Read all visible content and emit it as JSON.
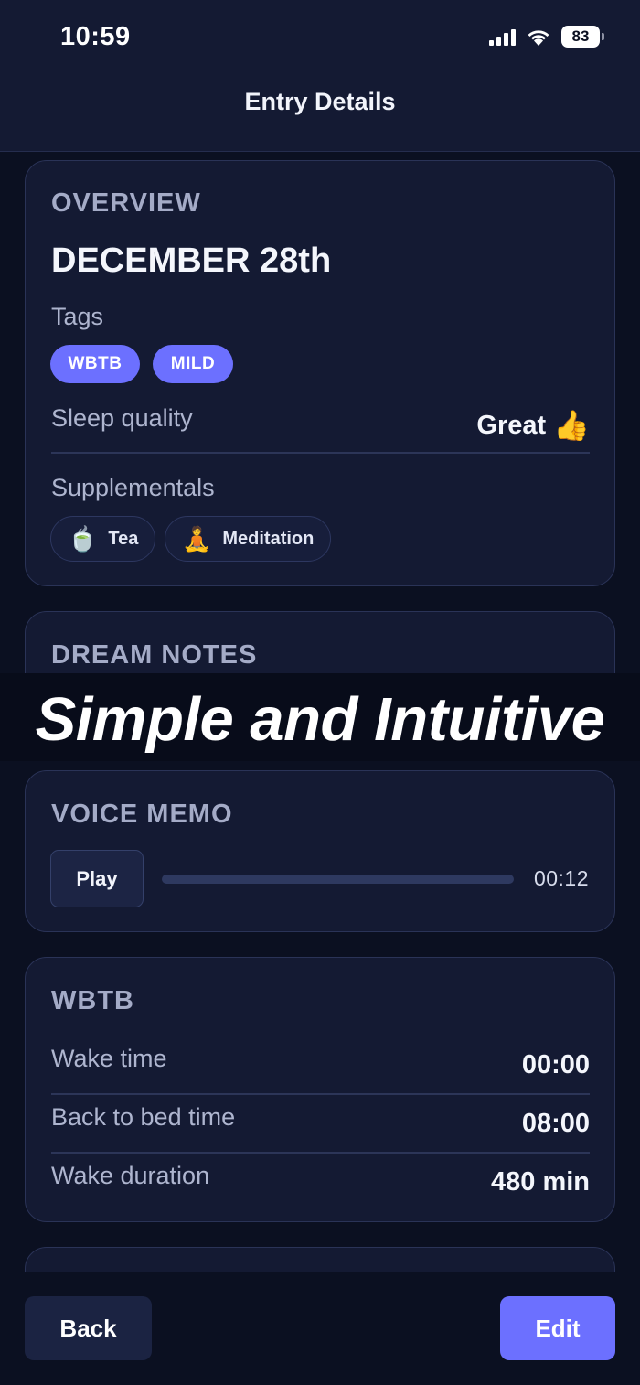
{
  "status_bar": {
    "time": "10:59",
    "battery": "83"
  },
  "header": {
    "title": "Entry Details"
  },
  "overview": {
    "section_title": "OVERVIEW",
    "date": "DECEMBER 28th",
    "tags_label": "Tags",
    "tags": [
      "WBTB",
      "MILD"
    ],
    "sleep_quality_label": "Sleep quality",
    "sleep_quality_value": "Great",
    "sleep_quality_emoji": "👍",
    "supplementals_label": "Supplementals",
    "supplementals": [
      {
        "emoji": "🍵",
        "label": "Tea"
      },
      {
        "emoji": "🧘",
        "label": "Meditation"
      }
    ]
  },
  "dream_notes": {
    "section_title": "DREAM NOTES"
  },
  "banner": {
    "text": "Simple and Intuitive"
  },
  "voice_memo": {
    "section_title": "VOICE MEMO",
    "play_label": "Play",
    "duration": "00:12",
    "progress": 0
  },
  "wbtb": {
    "section_title": "WBTB",
    "rows": [
      {
        "label": "Wake time",
        "value": "00:00"
      },
      {
        "label": "Back to bed time",
        "value": "08:00"
      },
      {
        "label": "Wake duration",
        "value": "480 min"
      }
    ]
  },
  "footer": {
    "back_label": "Back",
    "edit_label": "Edit"
  },
  "colors": {
    "accent": "#6c70ff",
    "background": "#0b1021",
    "card": "#141a33"
  }
}
